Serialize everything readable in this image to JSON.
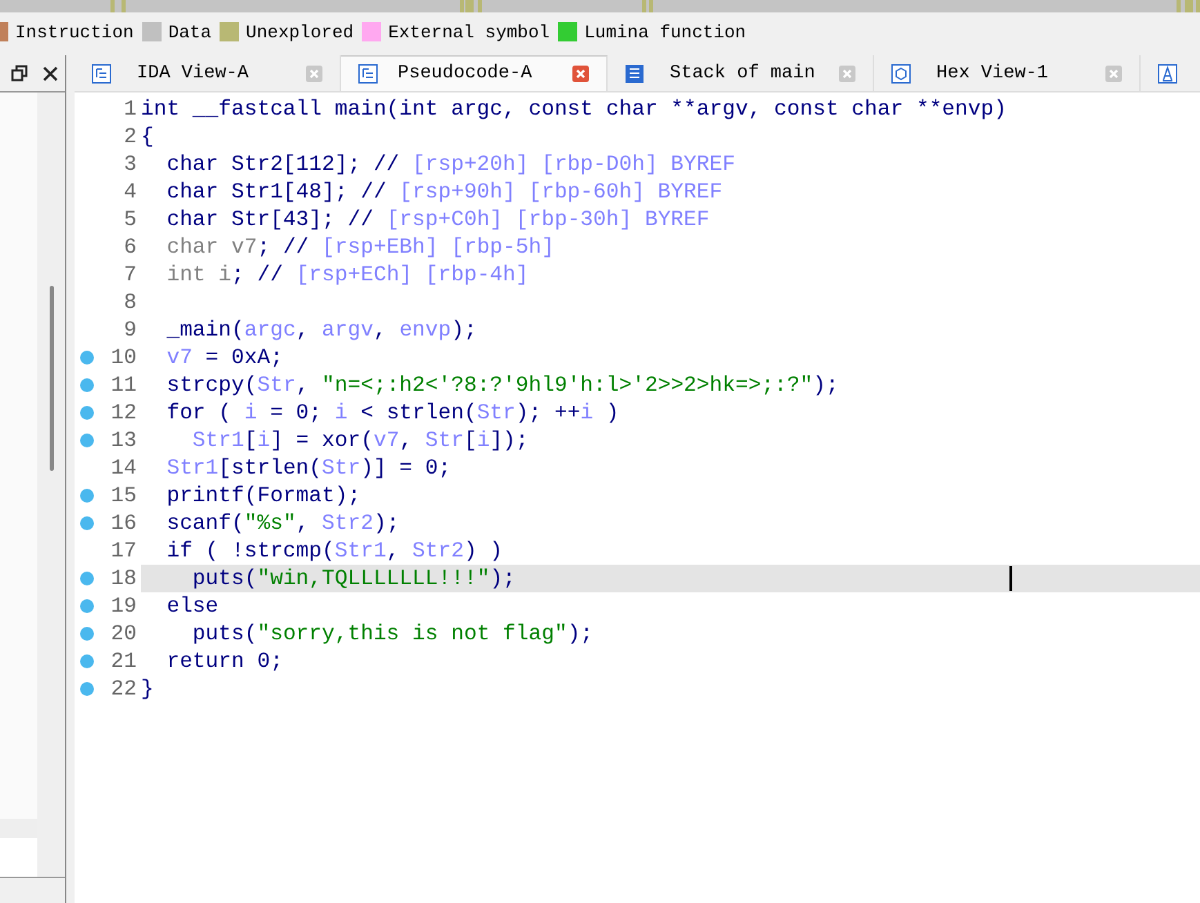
{
  "legend": [
    {
      "label": "Instruction",
      "color": "#c0805a"
    },
    {
      "label": "Data",
      "color": "#c0c0c0"
    },
    {
      "label": "Unexplored",
      "color": "#b8b874"
    },
    {
      "label": "External symbol",
      "color": "#ffa8f0"
    },
    {
      "label": "Lumina function",
      "color": "#33cc33"
    }
  ],
  "tabs": [
    {
      "label": "IDA View-A",
      "selected": false
    },
    {
      "label": "Pseudocode-A",
      "selected": true
    },
    {
      "label": "Stack of main",
      "selected": false
    },
    {
      "label": "Hex View-1",
      "selected": false
    }
  ],
  "code": [
    {
      "num": "1",
      "breakpoint": false,
      "highlighted": false,
      "tokens": [
        {
          "kind": "plain",
          "text": "int __fastcall main(int argc, const char **argv, const char **envp)"
        }
      ]
    },
    {
      "num": "2",
      "breakpoint": false,
      "highlighted": false,
      "tokens": [
        {
          "kind": "plain",
          "text": "{"
        }
      ]
    },
    {
      "num": "3",
      "breakpoint": false,
      "highlighted": false,
      "tokens": [
        {
          "kind": "plain",
          "text": "  char Str2[112]; // "
        },
        {
          "kind": "comment",
          "text": "[rsp+20h] [rbp-D0h] BYREF"
        }
      ]
    },
    {
      "num": "4",
      "breakpoint": false,
      "highlighted": false,
      "tokens": [
        {
          "kind": "plain",
          "text": "  char Str1[48]; // "
        },
        {
          "kind": "comment",
          "text": "[rsp+90h] [rbp-60h] BYREF"
        }
      ]
    },
    {
      "num": "5",
      "breakpoint": false,
      "highlighted": false,
      "tokens": [
        {
          "kind": "plain",
          "text": "  char Str[43]; // "
        },
        {
          "kind": "comment",
          "text": "[rsp+C0h] [rbp-30h] BYREF"
        }
      ]
    },
    {
      "num": "6",
      "breakpoint": false,
      "highlighted": false,
      "tokens": [
        {
          "kind": "unused",
          "text": "  char v7"
        },
        {
          "kind": "plain",
          "text": "; // "
        },
        {
          "kind": "comment",
          "text": "[rsp+EBh] [rbp-5h]"
        }
      ]
    },
    {
      "num": "7",
      "breakpoint": false,
      "highlighted": false,
      "tokens": [
        {
          "kind": "unused",
          "text": "  int i"
        },
        {
          "kind": "plain",
          "text": "; // "
        },
        {
          "kind": "comment",
          "text": "[rsp+ECh] [rbp-4h]"
        }
      ]
    },
    {
      "num": "8",
      "breakpoint": false,
      "highlighted": false
    },
    {
      "num": "9",
      "breakpoint": false,
      "highlighted": false,
      "tokens": [
        {
          "kind": "plain",
          "text": "  _main("
        },
        {
          "kind": "variable",
          "text": "argc"
        },
        {
          "kind": "plain",
          "text": ", "
        },
        {
          "kind": "variable",
          "text": "argv"
        },
        {
          "kind": "plain",
          "text": ", "
        },
        {
          "kind": "variable",
          "text": "envp"
        },
        {
          "kind": "plain",
          "text": ");"
        }
      ]
    },
    {
      "num": "10",
      "breakpoint": true,
      "highlighted": false,
      "tokens": [
        {
          "kind": "variable",
          "text": "  v7"
        },
        {
          "kind": "plain",
          "text": " = 0xA;"
        }
      ]
    },
    {
      "num": "11",
      "breakpoint": true,
      "highlighted": false,
      "tokens": [
        {
          "kind": "plain",
          "text": "  strcpy("
        },
        {
          "kind": "variable",
          "text": "Str"
        },
        {
          "kind": "plain",
          "text": ", "
        },
        {
          "kind": "string",
          "text": "\"n=<;:h2<'?8:?'9hl9'h:l>'2>>2>hk=>;:?\""
        },
        {
          "kind": "plain",
          "text": ");"
        }
      ]
    },
    {
      "num": "12",
      "breakpoint": true,
      "highlighted": false,
      "tokens": [
        {
          "kind": "plain",
          "text": "  for ( "
        },
        {
          "kind": "variable",
          "text": "i"
        },
        {
          "kind": "plain",
          "text": " = 0; "
        },
        {
          "kind": "variable",
          "text": "i"
        },
        {
          "kind": "plain",
          "text": " < strlen("
        },
        {
          "kind": "variable",
          "text": "Str"
        },
        {
          "kind": "plain",
          "text": "); ++"
        },
        {
          "kind": "variable",
          "text": "i"
        },
        {
          "kind": "plain",
          "text": " )"
        }
      ]
    },
    {
      "num": "13",
      "breakpoint": true,
      "highlighted": false,
      "tokens": [
        {
          "kind": "variable",
          "text": "    Str1"
        },
        {
          "kind": "plain",
          "text": "["
        },
        {
          "kind": "variable",
          "text": "i"
        },
        {
          "kind": "plain",
          "text": "] = xor("
        },
        {
          "kind": "variable",
          "text": "v7"
        },
        {
          "kind": "plain",
          "text": ", "
        },
        {
          "kind": "variable",
          "text": "Str"
        },
        {
          "kind": "plain",
          "text": "["
        },
        {
          "kind": "variable",
          "text": "i"
        },
        {
          "kind": "plain",
          "text": "]);"
        }
      ]
    },
    {
      "num": "14",
      "breakpoint": false,
      "highlighted": false,
      "tokens": [
        {
          "kind": "variable",
          "text": "  Str1"
        },
        {
          "kind": "plain",
          "text": "[strlen("
        },
        {
          "kind": "variable",
          "text": "Str"
        },
        {
          "kind": "plain",
          "text": ")] = 0;"
        }
      ]
    },
    {
      "num": "15",
      "breakpoint": true,
      "highlighted": false,
      "tokens": [
        {
          "kind": "plain",
          "text": "  printf(Format);"
        }
      ]
    },
    {
      "num": "16",
      "breakpoint": true,
      "highlighted": false,
      "tokens": [
        {
          "kind": "plain",
          "text": "  scanf("
        },
        {
          "kind": "string",
          "text": "\"%s\""
        },
        {
          "kind": "plain",
          "text": ", "
        },
        {
          "kind": "variable",
          "text": "Str2"
        },
        {
          "kind": "plain",
          "text": ");"
        }
      ]
    },
    {
      "num": "17",
      "breakpoint": false,
      "highlighted": false,
      "tokens": [
        {
          "kind": "plain",
          "text": "  if ( !strcmp("
        },
        {
          "kind": "variable",
          "text": "Str1"
        },
        {
          "kind": "plain",
          "text": ", "
        },
        {
          "kind": "variable",
          "text": "Str2"
        },
        {
          "kind": "plain",
          "text": ") )"
        }
      ]
    },
    {
      "num": "18",
      "breakpoint": true,
      "highlighted": true,
      "tokens": [
        {
          "kind": "plain",
          "text": "    puts("
        },
        {
          "kind": "string",
          "text": "\"win,TQLLLLLLL!!!\""
        },
        {
          "kind": "plain",
          "text": ");"
        }
      ]
    },
    {
      "num": "19",
      "breakpoint": true,
      "highlighted": false,
      "tokens": [
        {
          "kind": "plain",
          "text": "  else"
        }
      ]
    },
    {
      "num": "20",
      "breakpoint": true,
      "highlighted": false,
      "tokens": [
        {
          "kind": "plain",
          "text": "    puts("
        },
        {
          "kind": "string",
          "text": "\"sorry,this is not flag\""
        },
        {
          "kind": "plain",
          "text": ");"
        }
      ]
    },
    {
      "num": "21",
      "breakpoint": true,
      "highlighted": false,
      "tokens": [
        {
          "kind": "plain",
          "text": "  return 0;"
        }
      ]
    },
    {
      "num": "22",
      "breakpoint": true,
      "highlighted": false,
      "tokens": [
        {
          "kind": "plain",
          "text": "}"
        }
      ]
    }
  ]
}
